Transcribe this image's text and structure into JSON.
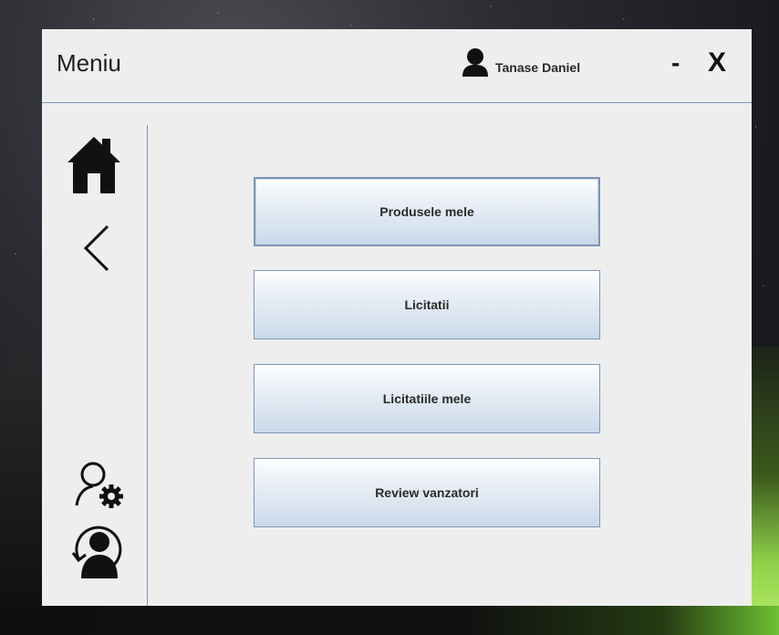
{
  "window": {
    "title": "Meniu",
    "user_name": "Tanase Daniel",
    "minimize_label": "-",
    "close_label": "X"
  },
  "sidebar": {
    "icons": [
      "home-icon",
      "back-arrow-icon",
      "user-settings-icon",
      "switch-user-icon"
    ]
  },
  "menu": {
    "buttons": [
      {
        "label": "Produsele mele",
        "focused": true
      },
      {
        "label": "Licitatii",
        "focused": false
      },
      {
        "label": "Licitatiile mele",
        "focused": false
      },
      {
        "label": "Review vanzatori",
        "focused": false
      }
    ]
  },
  "colors": {
    "window_bg": "#eeeeee",
    "accent_line": "#7c95b8",
    "button_border": "#7d96b6"
  }
}
